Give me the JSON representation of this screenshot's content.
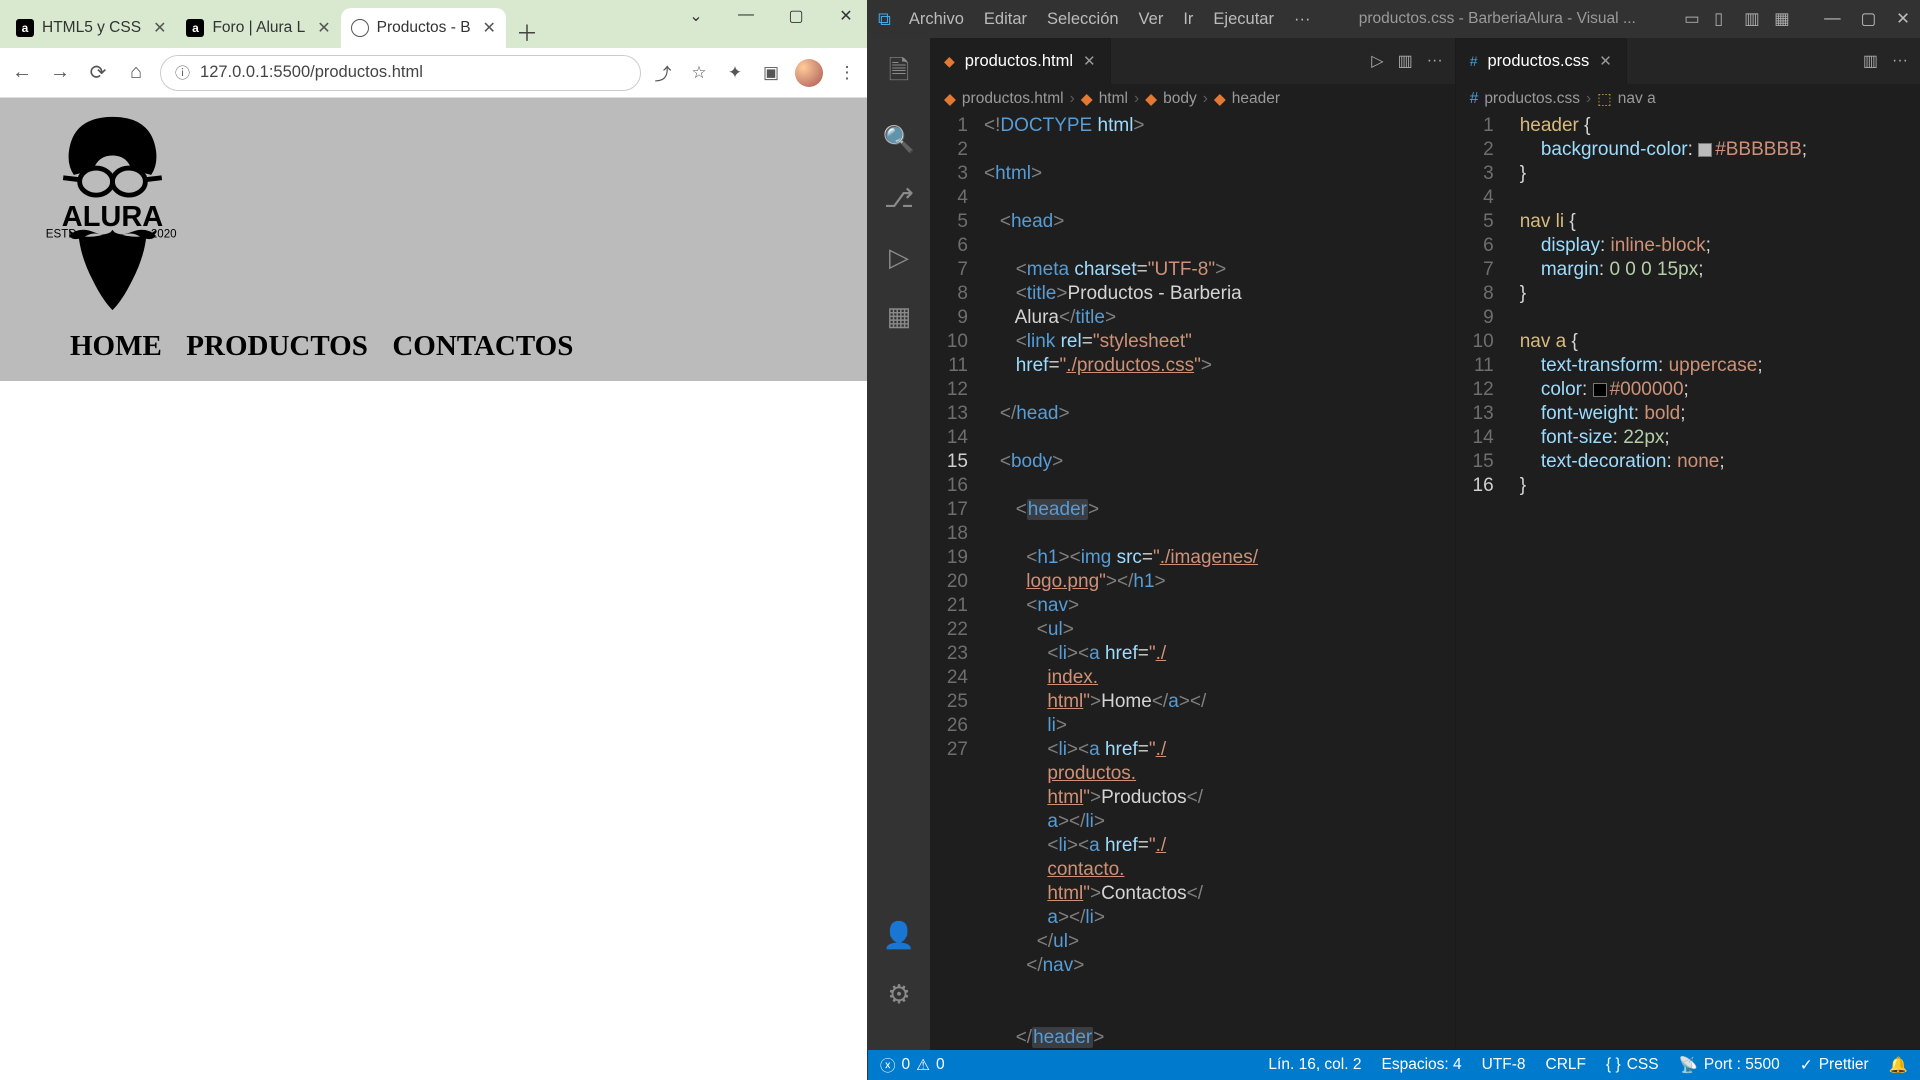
{
  "browser": {
    "tabs": [
      {
        "title": "HTML5 y CSS",
        "favicon": "a"
      },
      {
        "title": "Foro | Alura L",
        "favicon": "a"
      },
      {
        "title": "Productos - B",
        "favicon": "globe",
        "active": true
      }
    ],
    "window_buttons": [
      "⌄",
      "—",
      "▢",
      "✕"
    ],
    "address_icon": "ⓘ",
    "address": "127.0.0.1:5500/productos.html",
    "actions": [
      "⤴",
      "☆",
      "✦",
      "▣"
    ],
    "menu_dots": "⋮",
    "page": {
      "logo_top": "ALURA",
      "logo_left": "ESTD",
      "logo_right": "2020",
      "nav": [
        "HOME",
        "PRODUCTOS",
        "CONTACTOS"
      ]
    }
  },
  "vscode": {
    "menus": [
      "Archivo",
      "Editar",
      "Selección",
      "Ver",
      "Ir",
      "Ejecutar",
      "···"
    ],
    "window_title": "productos.css - BarberiaAlura - Visual ...",
    "layout_icons": [
      "▭",
      "▯",
      "▥",
      "▦"
    ],
    "winctl": [
      "—",
      "▢",
      "✕"
    ],
    "activity": [
      "🗎",
      "🔍",
      "⎇",
      "▷",
      "▦"
    ],
    "activity_bottom": [
      "👤",
      "⚙"
    ],
    "left_tab": "productos.html",
    "right_tab": "productos.css",
    "breadcrumb_left": [
      "productos.html",
      "html",
      "body",
      "header"
    ],
    "breadcrumb_right": [
      "productos.css",
      "nav a"
    ],
    "code_left_lines": [
      1,
      2,
      3,
      4,
      5,
      6,
      7,
      8,
      9,
      10,
      11,
      12,
      13,
      14,
      15,
      16,
      17,
      18,
      19,
      20,
      21,
      22,
      23,
      24,
      25,
      26,
      27
    ],
    "code_right_lines": [
      1,
      2,
      3,
      4,
      5,
      6,
      7,
      8,
      9,
      10,
      11,
      12,
      13,
      14,
      15,
      16
    ],
    "html_source": {
      "title_text": "Productos - Barberia Alura",
      "charset": "UTF-8",
      "stylesheet": "./productos.css",
      "logo_src": "./imagenes/logo.png",
      "links": [
        {
          "href": "./index.html",
          "text": "Home"
        },
        {
          "href": "./productos.html",
          "text": "Productos"
        },
        {
          "href": "./contacto.html",
          "text": "Contactos"
        }
      ]
    },
    "css_source": {
      "header_bg": "#BBBBBB",
      "navli_display": "inline-block",
      "navli_margin": "0 0 0 15px",
      "nava_transform": "uppercase",
      "nava_color": "#000000",
      "nava_weight": "bold",
      "nava_size": "22px",
      "nava_deco": "none"
    },
    "status": {
      "errors": "0",
      "warnings": "0",
      "cursor": "Lín. 16, col. 2",
      "spaces": "Espacios: 4",
      "encoding": "UTF-8",
      "eol": "CRLF",
      "lang": "CSS",
      "port": "Port : 5500",
      "prettier": "Prettier",
      "bell": "🔔"
    }
  }
}
